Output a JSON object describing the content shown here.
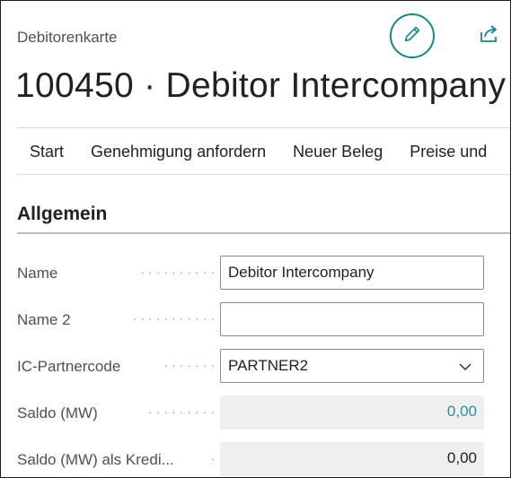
{
  "header": {
    "caption": "Debitorenkarte",
    "title": "100450 · Debitor Intercompany"
  },
  "actions": [
    "Start",
    "Genehmigung anfordern",
    "Neuer Beleg",
    "Preise und"
  ],
  "section": {
    "title": "Allgemein"
  },
  "fields": {
    "name": {
      "label": "Name",
      "value": "Debitor Intercompany"
    },
    "name2": {
      "label": "Name 2",
      "value": ""
    },
    "ic_partner": {
      "label": "IC-Partnercode",
      "value": "PARTNER2"
    },
    "balance": {
      "label": "Saldo (MW)",
      "value": "0,00"
    },
    "balance_vendor": {
      "label": "Saldo (MW) als Kredi...",
      "value": "0,00"
    }
  },
  "colors": {
    "accent": "#0f8a8a",
    "link": "#2a8ea0"
  },
  "icons": [
    "pencil-icon",
    "share-icon",
    "chevron-down-icon"
  ]
}
